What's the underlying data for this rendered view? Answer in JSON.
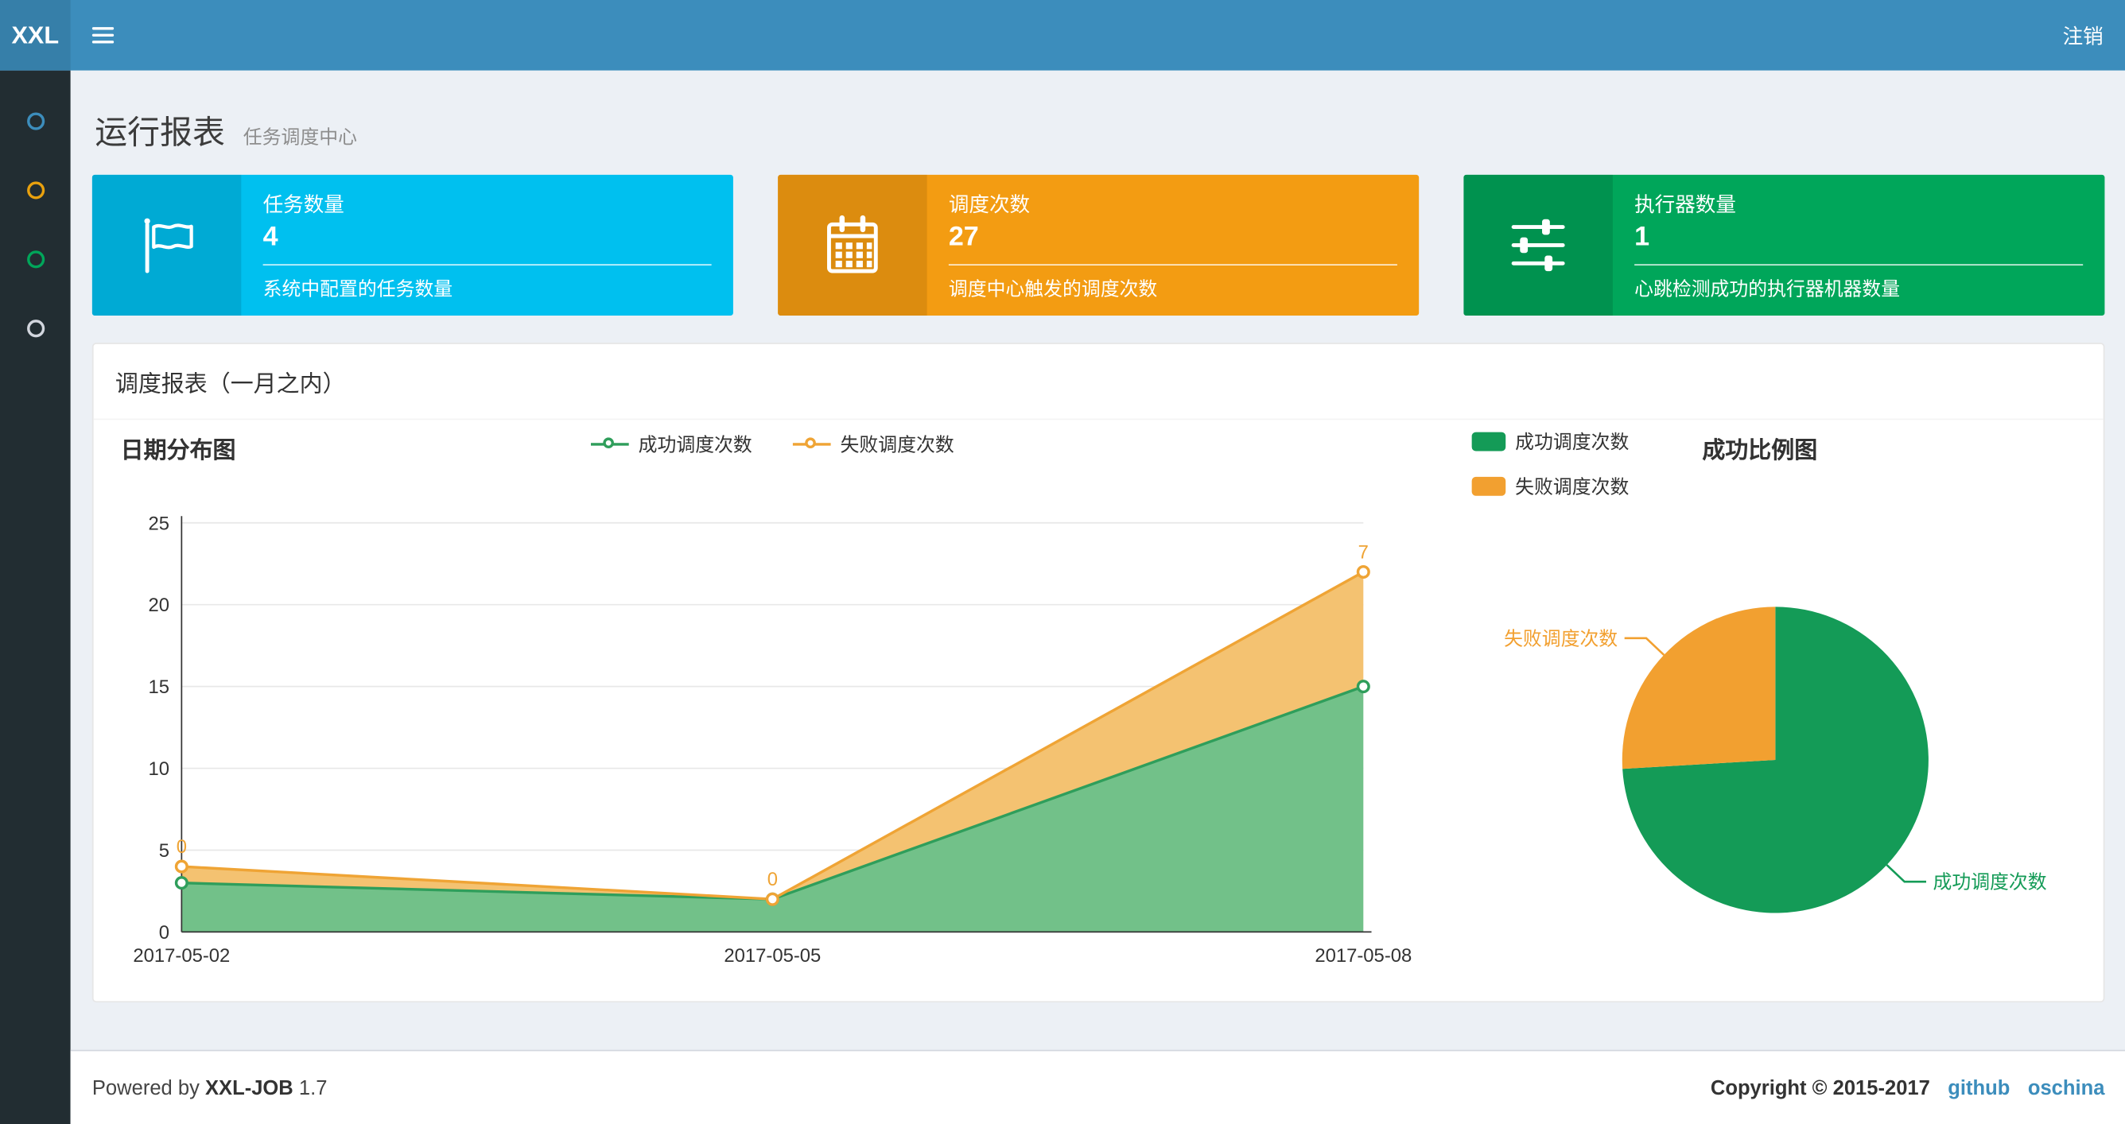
{
  "theme": {
    "navbar_bg": "#3c8dbc",
    "logo_bg": "#367fa9",
    "sidebar_bg": "#222d32",
    "content_bg": "#ecf0f5",
    "link_color": "#3c8dbc"
  },
  "navbar": {
    "logo": "XXL",
    "logout_label": "注销"
  },
  "sidebar": {
    "icon_colors": [
      "#3c8dbc",
      "#e9a10e",
      "#00a65a",
      "#d2d6de"
    ]
  },
  "page_header": {
    "title": "运行报表",
    "subtitle": "任务调度中心"
  },
  "info_boxes": [
    {
      "label": "任务数量",
      "value": "4",
      "desc": "系统中配置的任务数量",
      "bg": "#00c0ef",
      "icon_bg": "#00aad4",
      "icon": "flag-icon"
    },
    {
      "label": "调度次数",
      "value": "27",
      "desc": "调度中心触发的调度次数",
      "bg": "#f39c12",
      "icon_bg": "#dc8c0f",
      "icon": "calendar-icon"
    },
    {
      "label": "执行器数量",
      "value": "1",
      "desc": "心跳检测成功的执行器机器数量",
      "bg": "#00a65a",
      "icon_bg": "#00924f",
      "icon": "sliders-icon"
    }
  ],
  "panel": {
    "title": "调度报表（一月之内）"
  },
  "chart_data": [
    {
      "type": "area",
      "title": "日期分布图",
      "x": [
        "2017-05-02",
        "2017-05-05",
        "2017-05-08"
      ],
      "series": [
        {
          "name": "成功调度次数",
          "color": "#2f9e5b",
          "fill": "#72c189",
          "values": [
            3,
            2,
            15
          ]
        },
        {
          "name": "失败调度次数",
          "color": "#efa435",
          "fill": "#f4c271",
          "values": [
            1,
            0,
            7
          ],
          "point_labels": [
            "0",
            "0",
            "7"
          ]
        }
      ],
      "stacked": true,
      "ylim": [
        0,
        25
      ],
      "yticks": [
        0,
        5,
        10,
        15,
        20,
        25
      ],
      "grid": true,
      "legend_position": "top"
    },
    {
      "type": "pie",
      "title": "成功比例图",
      "slices": [
        {
          "name": "成功调度次数",
          "value": 20,
          "color": "#149b57"
        },
        {
          "name": "失败调度次数",
          "value": 7,
          "color": "#f2a030"
        }
      ],
      "legend_position": "top-left"
    }
  ],
  "footer": {
    "powered_prefix": "Powered by",
    "product": "XXL-JOB",
    "version": "1.7",
    "copyright": "Copyright © 2015-2017",
    "links": [
      {
        "label": "github"
      },
      {
        "label": "oschina"
      }
    ]
  }
}
